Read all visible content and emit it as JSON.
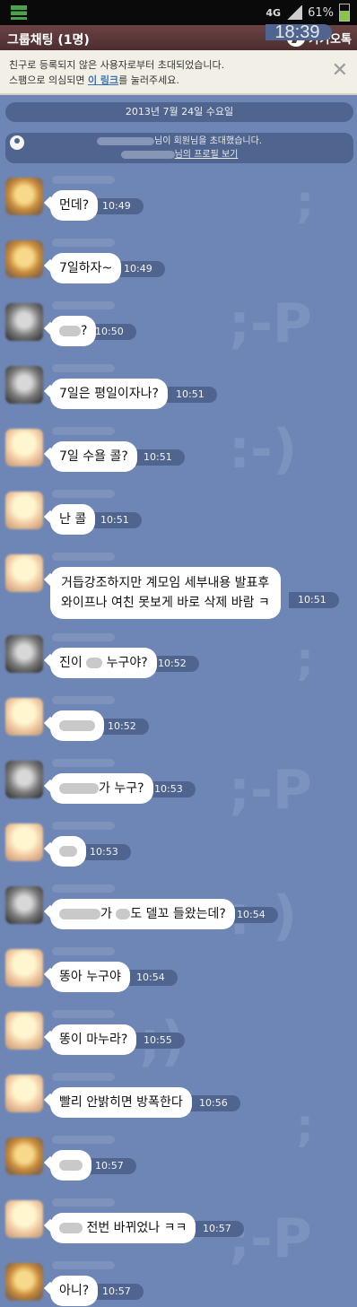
{
  "status_bar": {
    "network": "4G",
    "battery": "61%",
    "time": "18:39"
  },
  "header": {
    "title": "그룹채팅 (1명)",
    "brand": "카카오톡"
  },
  "notice": {
    "line1": "친구로 등록되지 않은 사용자로부터 초대되었습니다.",
    "line2_pre": "스팸으로 의심되면 ",
    "line2_link": "이 링크",
    "line2_post": "를 눌러주세요."
  },
  "date_divider": "2013년 7월 24일 수요일",
  "system_message": {
    "invite_suffix": "님이 회원님을 초대했습니다.",
    "profile_link": "님의 프로필 보기"
  },
  "messages": [
    {
      "text": "먼데?",
      "time": "10:49"
    },
    {
      "text": "7일하자~",
      "time": "10:49"
    },
    {
      "text": "?",
      "time": "10:50"
    },
    {
      "text": "7일은 평일이자나?",
      "time": "10:51"
    },
    {
      "text": "7일 수욜 콜?",
      "time": "10:51"
    },
    {
      "text": "난 콜",
      "time": "10:51"
    },
    {
      "text_line1": "거듭강조하지만 계모임 세부내용 발표후",
      "text_line2": "와이프나 여친 못보게 바로 삭제 바람 ㅋ",
      "time": "10:51"
    },
    {
      "text_pre": "진이 ",
      "text_post": " 누구야?",
      "time": "10:52"
    },
    {
      "text": "",
      "time": "10:52"
    },
    {
      "text": "가 누구?",
      "time": "10:53"
    },
    {
      "text": "",
      "time": "10:53"
    },
    {
      "text_mid": "가 ",
      "text_post": "도 델꼬 들왔는데?",
      "time": "10:54"
    },
    {
      "text": "똥아 누구야",
      "time": "10:54"
    },
    {
      "text": "똥이 마누라?",
      "time": "10:55"
    },
    {
      "text": "빨리 안밝히면 방폭한다",
      "time": "10:56"
    },
    {
      "text": "",
      "time": "10:57"
    },
    {
      "text": " 전번 바뀌었나 ㅋㅋ",
      "time": "10:57"
    },
    {
      "text": "아니?",
      "time": "10:57"
    }
  ],
  "icons": {
    "app": "app-grid-icon",
    "signal": "signal-icon",
    "battery": "battery-icon",
    "logo": "kakaotalk-logo-icon",
    "close": "close-icon",
    "person": "person-icon"
  }
}
